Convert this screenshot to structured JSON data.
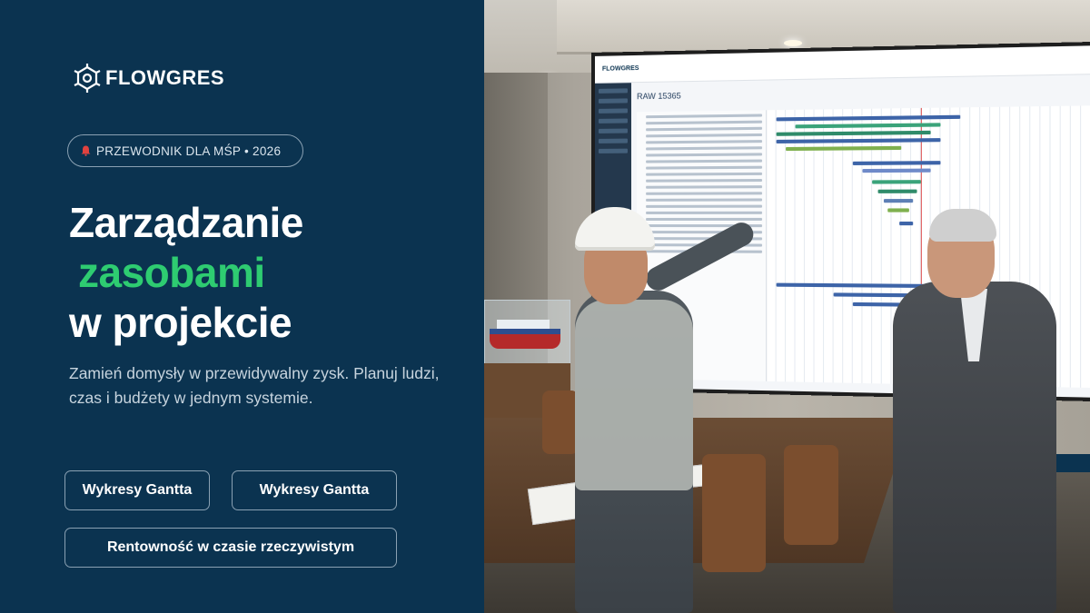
{
  "brand": {
    "logo_text": "FLOWGRES"
  },
  "badge": {
    "icon": "bell-icon",
    "text": "PRZEWODNIK DLA MŚP • 2026"
  },
  "headline": {
    "line1": "Zarządzanie",
    "line2": "zasobami",
    "line3": "w projekcie"
  },
  "subtitle": "Zamień domysły w przewidywalny zysk. Planuj ludzi, czas i budżety w jednym systemie.",
  "buttons": {
    "first": "Wykresy Gantta",
    "second": "Wykresy Gantta",
    "third": "Rentowność w czasie rzeczywistym"
  },
  "colors": {
    "background": "#0b3350",
    "accent": "#2ecc71",
    "text": "#ffffff"
  },
  "photo": {
    "screen_app": "FLOWGRES",
    "screen_title": "RAW 15365"
  }
}
